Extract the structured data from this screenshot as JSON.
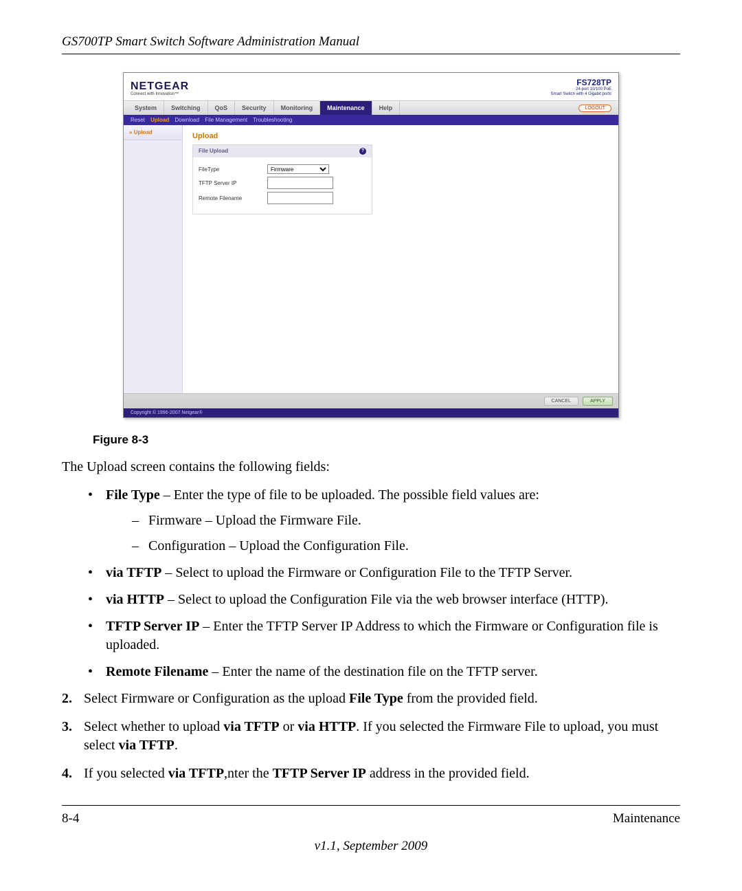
{
  "header": {
    "running_title": "GS700TP Smart Switch Software Administration Manual"
  },
  "screenshot": {
    "brand": "NETGEAR",
    "brand_tag": "Connect with Innovation™",
    "model": "FS728TP",
    "model_sub1": "24-port 10/100 PoE",
    "model_sub2": "Smart Switch with 4 Gigabit ports",
    "tabs": [
      "System",
      "Switching",
      "QoS",
      "Security",
      "Monitoring",
      "Maintenance",
      "Help"
    ],
    "active_tab": "Maintenance",
    "logout": "LOGOUT",
    "subnav": [
      "Reset",
      "Upload",
      "Download",
      "File Management",
      "Troubleshooting"
    ],
    "subnav_active": "Upload",
    "sidebar_item": "» Upload",
    "panel_title": "Upload",
    "panel_head": "File Upload",
    "fields": {
      "file_type_label": "FileType",
      "file_type_value": "Firmware",
      "tftp_ip_label": "TFTP Server IP",
      "remote_label": "Remote Filename"
    },
    "buttons": {
      "cancel": "CANCEL",
      "apply": "APPLY"
    },
    "copyright": "Copyright © 1996-2007 Netgear®"
  },
  "caption": "Figure 8-3",
  "intro": "The Upload screen contains the following fields:",
  "bullets": {
    "file_type": {
      "term": "File Type",
      "text": " – Enter the type of file to be uploaded. The possible field values are:"
    },
    "firmware": "Firmware – Upload the Firmware File.",
    "configuration": "Configuration – Upload the Configuration File.",
    "via_tftp": {
      "term": "via TFTP",
      "text": " – Select to upload the Firmware or Configuration File to the TFTP Server."
    },
    "via_http": {
      "term": "via HTTP",
      "text": " – Select to upload the Configuration File via the web browser interface (HTTP)."
    },
    "tftp_ip": {
      "term": "TFTP Server IP",
      "text": " – Enter the TFTP Server IP Address to which the Firmware or Configuration file is uploaded."
    },
    "remote": {
      "term": "Remote Filename",
      "text": " – Enter the name of the destination file on the TFTP server."
    }
  },
  "steps": {
    "s2": {
      "num": "2.",
      "pre": "Select Firmware or Configuration as the upload ",
      "b1": "File Type",
      "post": " from the provided field."
    },
    "s3": {
      "num": "3.",
      "pre": "Select whether to upload ",
      "b1": "via TFTP",
      "mid1": " or ",
      "b2": "via HTTP",
      "mid2": ". If you selected the Firmware File to upload, you must select ",
      "b3": "via TFTP",
      "post": "."
    },
    "s4": {
      "num": "4.",
      "pre": "If you selected ",
      "b1": "via TFTP",
      "mid1": ",nter the ",
      "b2": "TFTP Server IP",
      "post": " address in the provided field."
    }
  },
  "footer": {
    "page": "8-4",
    "section": "Maintenance",
    "version": "v1.1, September 2009"
  }
}
